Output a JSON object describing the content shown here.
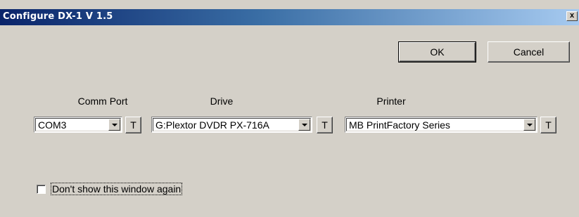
{
  "window": {
    "title": "Configure  DX-1 V 1.5",
    "close_glyph": "x"
  },
  "buttons": {
    "ok_label": "OK",
    "cancel_label": "Cancel"
  },
  "fields": {
    "comm_port": {
      "label": "Comm Port",
      "value": "COM3",
      "test_label": "T"
    },
    "drive": {
      "label": "Drive",
      "value": "G:Plextor DVDR PX-716A",
      "test_label": "T"
    },
    "printer": {
      "label": "Printer",
      "value": "MB PrintFactory Series",
      "test_label": "T"
    }
  },
  "dont_show": {
    "label": "Don't show this window again",
    "checked": false
  },
  "icons": {
    "close": "close-icon",
    "dropdown": "chevron-down-icon"
  }
}
